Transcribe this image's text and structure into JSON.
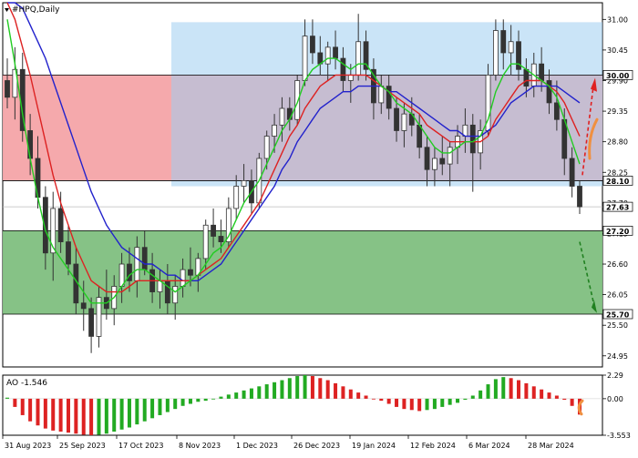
{
  "chart_data": [
    {
      "type": "candlestick",
      "title": "#HPQ,Daily",
      "ylim": [
        24.75,
        31.3
      ],
      "y_ticks": [
        "31.00",
        "30.45",
        "29.90",
        "29.35",
        "28.80",
        "28.25",
        "27.70",
        "27.15",
        "26.60",
        "26.05",
        "25.50",
        "24.95"
      ],
      "x_ticks": [
        "31 Aug 2023",
        "25 Sep 2023",
        "17 Oct 2023",
        "8 Nov 2023",
        "1 Dec 2023",
        "26 Dec 2023",
        "19 Jan 2024",
        "12 Feb 2024",
        "6 Mar 2024",
        "28 Mar 2024"
      ],
      "levels": [
        {
          "value": "30.00",
          "color": "#000000"
        },
        {
          "value": "28.10",
          "color": "#000000"
        },
        {
          "value": "27.20",
          "color": "#000000"
        },
        {
          "value": "25.70",
          "color": "#000000"
        }
      ],
      "current_price": "27.63",
      "zones": [
        {
          "name": "sell-zone",
          "y_from": 28.1,
          "y_to": 30.0,
          "color": "#f4a4a8"
        },
        {
          "name": "buy-zone",
          "y_from": 25.7,
          "y_to": 27.2,
          "color": "#7fbf7f"
        },
        {
          "name": "range-box",
          "y_from": 28.0,
          "y_to": 30.95,
          "color": "#9ecdf0"
        }
      ],
      "ma_colors": {
        "fast": "#22cc22",
        "mid": "#dd2222",
        "slow": "#2222cc"
      },
      "candles": [
        [
          29.9,
          30.3,
          29.4,
          29.6
        ],
        [
          29.6,
          30.5,
          29.2,
          30.1
        ],
        [
          30.1,
          30.4,
          28.8,
          29.0
        ],
        [
          29.0,
          29.3,
          28.2,
          28.5
        ],
        [
          28.5,
          28.9,
          27.6,
          27.8
        ],
        [
          27.8,
          28.0,
          26.5,
          26.8
        ],
        [
          26.8,
          27.9,
          26.3,
          27.6
        ],
        [
          27.6,
          27.9,
          26.8,
          27.0
        ],
        [
          27.0,
          27.3,
          26.4,
          26.6
        ],
        [
          26.6,
          26.9,
          25.7,
          25.9
        ],
        [
          25.9,
          26.3,
          25.4,
          25.8
        ],
        [
          25.8,
          26.0,
          25.0,
          25.3
        ],
        [
          25.3,
          26.2,
          25.1,
          26.0
        ],
        [
          26.0,
          26.5,
          25.6,
          25.8
        ],
        [
          25.8,
          26.4,
          25.5,
          26.2
        ],
        [
          26.2,
          26.8,
          25.9,
          26.6
        ],
        [
          26.6,
          26.9,
          26.1,
          26.3
        ],
        [
          26.3,
          27.1,
          26.0,
          26.9
        ],
        [
          26.9,
          27.2,
          26.4,
          26.5
        ],
        [
          26.5,
          26.8,
          25.9,
          26.1
        ],
        [
          26.1,
          26.5,
          25.8,
          26.3
        ],
        [
          26.3,
          26.6,
          25.7,
          25.9
        ],
        [
          25.9,
          26.4,
          25.6,
          26.2
        ],
        [
          26.2,
          26.7,
          26.0,
          26.5
        ],
        [
          26.5,
          26.9,
          26.2,
          26.4
        ],
        [
          26.4,
          26.8,
          26.1,
          26.7
        ],
        [
          26.7,
          27.4,
          26.5,
          27.3
        ],
        [
          27.3,
          27.6,
          26.9,
          27.1
        ],
        [
          27.1,
          27.4,
          26.8,
          27.0
        ],
        [
          27.0,
          27.8,
          26.9,
          27.6
        ],
        [
          27.6,
          28.2,
          27.4,
          28.0
        ],
        [
          28.0,
          28.4,
          27.7,
          28.1
        ],
        [
          28.1,
          28.3,
          27.5,
          27.7
        ],
        [
          27.7,
          28.6,
          27.6,
          28.5
        ],
        [
          28.5,
          29.0,
          28.3,
          28.9
        ],
        [
          28.9,
          29.3,
          28.6,
          29.1
        ],
        [
          29.1,
          29.6,
          28.8,
          29.4
        ],
        [
          29.4,
          29.6,
          29.0,
          29.2
        ],
        [
          29.2,
          30.0,
          29.1,
          29.9
        ],
        [
          29.9,
          31.0,
          29.8,
          30.7
        ],
        [
          30.7,
          31.0,
          30.2,
          30.4
        ],
        [
          30.4,
          30.7,
          30.0,
          30.2
        ],
        [
          30.2,
          30.6,
          29.9,
          30.5
        ],
        [
          30.5,
          30.8,
          30.1,
          30.3
        ],
        [
          30.3,
          30.5,
          29.7,
          29.9
        ],
        [
          29.9,
          30.2,
          29.5,
          30.0
        ],
        [
          30.0,
          31.1,
          29.9,
          30.6
        ],
        [
          30.6,
          30.8,
          29.9,
          30.1
        ],
        [
          30.1,
          30.3,
          29.2,
          29.5
        ],
        [
          29.5,
          30.0,
          29.3,
          29.8
        ],
        [
          29.8,
          30.0,
          29.2,
          29.4
        ],
        [
          29.4,
          29.6,
          28.8,
          29.0
        ],
        [
          29.0,
          29.5,
          28.7,
          29.3
        ],
        [
          29.3,
          29.6,
          28.9,
          29.1
        ],
        [
          29.1,
          29.3,
          28.5,
          28.7
        ],
        [
          28.7,
          28.9,
          28.0,
          28.3
        ],
        [
          28.3,
          28.7,
          28.0,
          28.5
        ],
        [
          28.5,
          28.9,
          28.2,
          28.4
        ],
        [
          28.4,
          28.8,
          28.0,
          28.7
        ],
        [
          28.7,
          29.1,
          28.4,
          28.9
        ],
        [
          28.9,
          29.4,
          28.6,
          29.1
        ],
        [
          29.1,
          29.3,
          27.9,
          28.6
        ],
        [
          28.6,
          29.2,
          28.3,
          29.0
        ],
        [
          29.0,
          30.2,
          28.9,
          30.0
        ],
        [
          30.0,
          31.0,
          29.9,
          30.8
        ],
        [
          30.8,
          31.0,
          30.1,
          30.4
        ],
        [
          30.4,
          30.9,
          30.0,
          30.6
        ],
        [
          30.6,
          30.8,
          29.9,
          30.1
        ],
        [
          30.1,
          30.3,
          29.6,
          29.8
        ],
        [
          29.8,
          30.4,
          29.6,
          30.2
        ],
        [
          30.2,
          30.5,
          29.7,
          29.9
        ],
        [
          29.9,
          30.1,
          29.3,
          29.5
        ],
        [
          29.5,
          29.9,
          29.0,
          29.2
        ],
        [
          29.2,
          29.4,
          28.2,
          28.5
        ],
        [
          28.5,
          28.7,
          27.8,
          28.0
        ],
        [
          28.0,
          28.1,
          27.5,
          27.63
        ]
      ],
      "ma_fast": [
        31.0,
        30.2,
        29.3,
        28.5,
        27.8,
        27.2,
        26.9,
        26.7,
        26.5,
        26.3,
        26.1,
        25.9,
        25.9,
        25.9,
        26.0,
        26.2,
        26.4,
        26.5,
        26.5,
        26.4,
        26.3,
        26.2,
        26.1,
        26.2,
        26.3,
        26.4,
        26.6,
        26.8,
        26.9,
        27.1,
        27.4,
        27.7,
        27.9,
        28.1,
        28.4,
        28.7,
        29.0,
        29.2,
        29.5,
        29.9,
        30.1,
        30.2,
        30.3,
        30.3,
        30.2,
        30.1,
        30.2,
        30.2,
        30.0,
        29.8,
        29.7,
        29.5,
        29.4,
        29.3,
        29.1,
        28.9,
        28.7,
        28.6,
        28.6,
        28.7,
        28.8,
        28.8,
        28.9,
        29.2,
        29.7,
        30.0,
        30.2,
        30.2,
        30.1,
        30.0,
        29.9,
        29.8,
        29.6,
        29.2,
        28.8,
        28.4
      ],
      "ma_mid": [
        31.3,
        31.0,
        30.5,
        30.0,
        29.4,
        28.8,
        28.2,
        27.7,
        27.3,
        26.9,
        26.6,
        26.3,
        26.2,
        26.1,
        26.1,
        26.1,
        26.2,
        26.3,
        26.3,
        26.3,
        26.3,
        26.3,
        26.3,
        26.3,
        26.3,
        26.4,
        26.5,
        26.6,
        26.7,
        26.9,
        27.1,
        27.3,
        27.5,
        27.7,
        28.0,
        28.3,
        28.6,
        28.9,
        29.1,
        29.4,
        29.6,
        29.8,
        29.9,
        30.0,
        30.0,
        30.0,
        30.0,
        30.0,
        29.9,
        29.8,
        29.7,
        29.6,
        29.5,
        29.4,
        29.3,
        29.1,
        29.0,
        28.9,
        28.8,
        28.8,
        28.8,
        28.8,
        28.8,
        28.9,
        29.2,
        29.4,
        29.6,
        29.8,
        29.9,
        29.9,
        29.9,
        29.8,
        29.7,
        29.5,
        29.2,
        28.9
      ],
      "ma_slow": [
        31.3,
        31.3,
        31.2,
        30.9,
        30.6,
        30.3,
        29.9,
        29.5,
        29.1,
        28.7,
        28.3,
        27.9,
        27.6,
        27.3,
        27.1,
        26.9,
        26.8,
        26.7,
        26.6,
        26.6,
        26.5,
        26.4,
        26.4,
        26.3,
        26.3,
        26.3,
        26.4,
        26.5,
        26.6,
        26.8,
        27.0,
        27.2,
        27.4,
        27.6,
        27.8,
        28.0,
        28.3,
        28.5,
        28.8,
        29.0,
        29.2,
        29.4,
        29.5,
        29.6,
        29.7,
        29.7,
        29.8,
        29.8,
        29.8,
        29.8,
        29.7,
        29.7,
        29.6,
        29.5,
        29.4,
        29.3,
        29.2,
        29.1,
        29.0,
        29.0,
        28.9,
        28.9,
        28.9,
        29.0,
        29.1,
        29.3,
        29.5,
        29.6,
        29.7,
        29.8,
        29.8,
        29.8,
        29.8,
        29.7,
        29.6,
        29.5
      ]
    },
    {
      "type": "histogram",
      "title": "AO -1.546",
      "ylim": [
        -3.553,
        2.29
      ],
      "y_ticks": [
        "2.29",
        "0.00",
        "-3.553"
      ],
      "last_value": "-1.546",
      "up_color": "#22aa22",
      "down_color": "#dd2222",
      "values": [
        0.1,
        -0.8,
        -1.6,
        -2.2,
        -2.6,
        -2.9,
        -3.1,
        -3.2,
        -3.3,
        -3.4,
        -3.5,
        -3.55,
        -3.5,
        -3.4,
        -3.2,
        -3.0,
        -2.8,
        -2.5,
        -2.2,
        -1.9,
        -1.6,
        -1.3,
        -1.0,
        -0.7,
        -0.5,
        -0.3,
        -0.2,
        0.0,
        0.2,
        0.4,
        0.6,
        0.8,
        1.0,
        1.2,
        1.4,
        1.6,
        1.8,
        2.0,
        2.2,
        2.29,
        2.2,
        2.0,
        1.8,
        1.5,
        1.2,
        0.9,
        0.6,
        0.3,
        0.0,
        -0.2,
        -0.5,
        -0.8,
        -1.0,
        -1.1,
        -1.2,
        -1.1,
        -1.0,
        -0.8,
        -0.6,
        -0.4,
        -0.1,
        0.3,
        0.8,
        1.4,
        1.9,
        2.1,
        2.0,
        1.8,
        1.5,
        1.2,
        0.9,
        0.6,
        0.3,
        -0.1,
        -0.7,
        -1.546
      ]
    }
  ]
}
